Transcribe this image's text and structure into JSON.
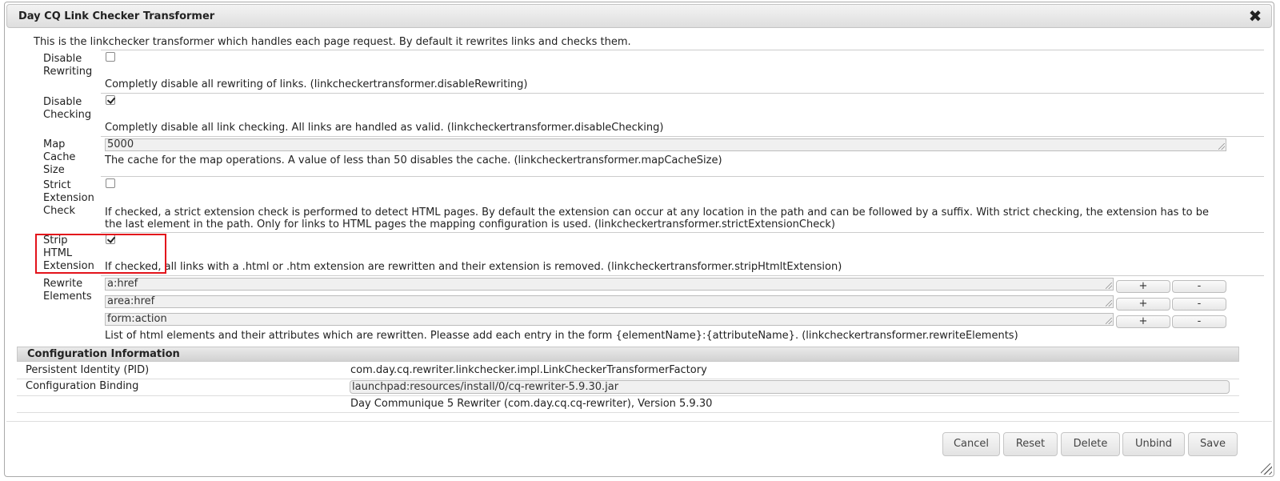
{
  "dialog": {
    "title": "Day CQ Link Checker Transformer",
    "close_glyph": "✖"
  },
  "intro": "This is the linkchecker transformer which handles each page request. By default it rewrites links and checks them.",
  "properties": {
    "disable_rewriting": {
      "label": "Disable Rewriting",
      "checked": false,
      "description": "Completly disable all rewriting of links. (linkcheckertransformer.disableRewriting)"
    },
    "disable_checking": {
      "label": "Disable Checking",
      "checked": true,
      "description": "Completly disable all link checking. All links are handled as valid. (linkcheckertransformer.disableChecking)"
    },
    "map_cache_size": {
      "label": "Map Cache Size",
      "value": "5000",
      "description": "The cache for the map operations. A value of less than 50 disables the cache. (linkcheckertransformer.mapCacheSize)"
    },
    "strict_extension_check": {
      "label": "Strict Extension Check",
      "checked": false,
      "description_line1": "If checked, a strict extension check is performed to detect HTML pages. By default the extension can occur at any location in the path and can be followed by a suffix. With strict checking, the extension has to be",
      "description_line2": "the last element in the path. Only for links to HTML pages the mapping configuration is used. (linkcheckertransformer.strictExtensionCheck)"
    },
    "strip_html_extension": {
      "label": "Strip HTML Extension",
      "checked": true,
      "description": "If checked, all links with a .html or .htm extension are rewritten and their extension is removed. (linkcheckertransformer.stripHtmltExtension)"
    },
    "rewrite_elements": {
      "label": "Rewrite Elements",
      "values": [
        "a:href",
        "area:href",
        "form:action"
      ],
      "add_label": "+",
      "remove_label": "-",
      "description": "List of html elements and their attributes which are rewritten. Pleasse add each entry in the form {elementName}:{attributeName}. (linkcheckertransformer.rewriteElements)"
    }
  },
  "config_info": {
    "header": "Configuration Information",
    "pid_label": "Persistent Identity (PID)",
    "pid_value": "com.day.cq.rewriter.linkchecker.impl.LinkCheckerTransformerFactory",
    "binding_label": "Configuration Binding",
    "binding_value": "launchpad:resources/install/0/cq-rewriter-5.9.30.jar",
    "bundle_value": "Day Communique 5 Rewriter (com.day.cq.cq-rewriter), Version 5.9.30"
  },
  "buttons": {
    "cancel": "Cancel",
    "reset": "Reset",
    "delete": "Delete",
    "unbind": "Unbind",
    "save": "Save"
  }
}
